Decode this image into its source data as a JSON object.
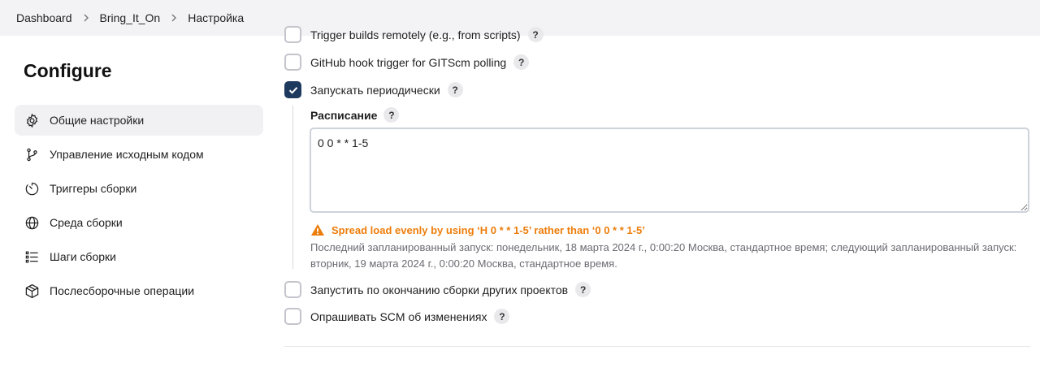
{
  "breadcrumb": [
    "Dashboard",
    "Bring_It_On",
    "Настройка"
  ],
  "sidebar": {
    "title": "Configure",
    "items": [
      {
        "label": "Общие настройки",
        "icon": "gear-icon",
        "active": true
      },
      {
        "label": "Управление исходным кодом",
        "icon": "git-branch-icon",
        "active": false
      },
      {
        "label": "Триггеры сборки",
        "icon": "timer-icon",
        "active": false
      },
      {
        "label": "Среда сборки",
        "icon": "globe-icon",
        "active": false
      },
      {
        "label": "Шаги сборки",
        "icon": "list-icon",
        "active": false
      },
      {
        "label": "Послесборочные операции",
        "icon": "package-icon",
        "active": false
      }
    ]
  },
  "triggers": {
    "remote": {
      "label": "Trigger builds remotely (e.g., from scripts)",
      "checked": false
    },
    "github": {
      "label": "GitHub hook trigger for GITScm polling",
      "checked": false
    },
    "periodic": {
      "label": "Запускать периодически",
      "checked": true
    },
    "after_other": {
      "label": "Запустить по окончанию сборки других проектов",
      "checked": false
    },
    "poll_scm": {
      "label": "Опрашивать SCM об изменениях",
      "checked": false
    }
  },
  "schedule": {
    "label": "Расписание",
    "value": "0 0 * * 1-5",
    "warning": "Spread load evenly by using ‘H 0 * * 1-5’ rather than ‘0 0 * * 1-5’",
    "info": "Последний запланированный запуск: понедельник, 18 марта 2024 г., 0:00:20 Москва, стандартное время; следующий запланированный запуск: вторник, 19 марта 2024 г., 0:00:20 Москва, стандартное время."
  },
  "help_symbol": "?",
  "colors": {
    "accent": "#1d3a5e",
    "warning": "#ed7d0a",
    "active_bg": "#f1f1f4"
  }
}
